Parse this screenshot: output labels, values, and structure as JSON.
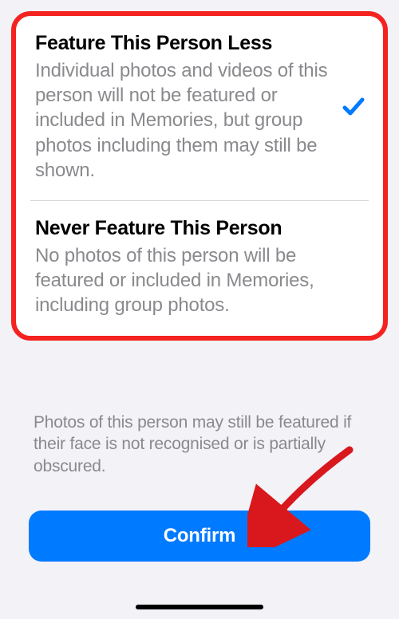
{
  "options": [
    {
      "title": "Feature This Person Less",
      "description": "Individual photos and videos of this person will not be featured or included in Memories, but group photos including them may still be shown.",
      "selected": true
    },
    {
      "title": "Never Feature This Person",
      "description": "No photos of this person will be featured or included in Memories, including group photos.",
      "selected": false
    }
  ],
  "footer_text": "Photos of this person may still be featured if their face is not recognised or is partially obscured.",
  "confirm_label": "Confirm",
  "colors": {
    "accent": "#007aff",
    "highlight_border": "#f4231f",
    "arrow": "#d8181c"
  }
}
